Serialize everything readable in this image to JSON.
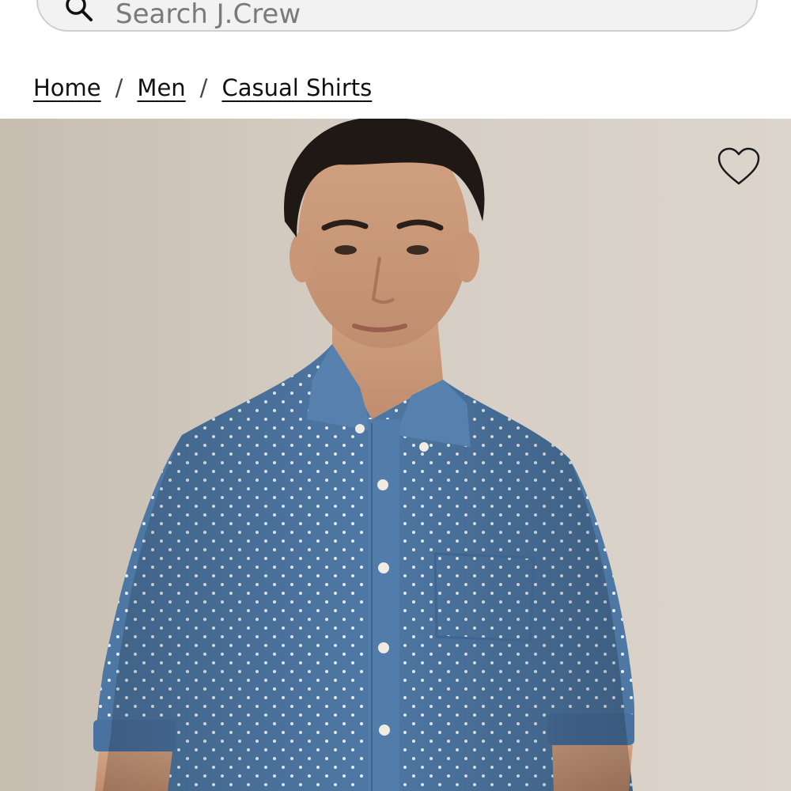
{
  "search": {
    "placeholder": "Search J.Crew",
    "value": ""
  },
  "breadcrumb": {
    "items": [
      {
        "label": "Home"
      },
      {
        "label": "Men"
      },
      {
        "label": "Casual Shirts"
      }
    ],
    "separator": "/"
  },
  "product": {
    "image_icon": "product-photo",
    "wishlist_icon": "heart-icon"
  },
  "colors": {
    "background": "#ffffff",
    "search_bg": "#f2f2f2",
    "studio_backdrop": "#d3cbc0",
    "shirt_blue": "#4f79a6"
  }
}
